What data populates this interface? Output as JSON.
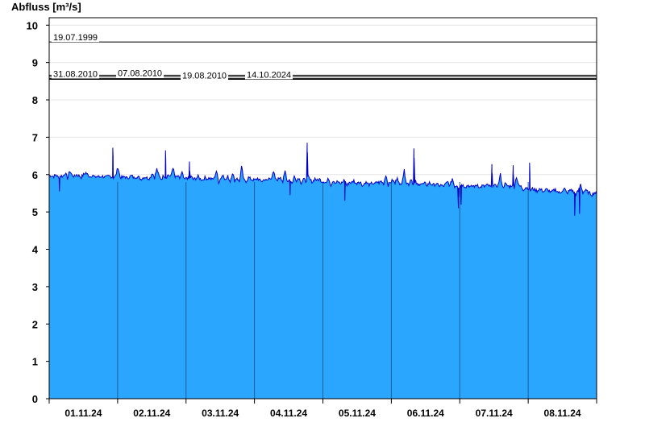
{
  "chart_data": {
    "type": "area",
    "ylabel": "Abfluss [m³/s]",
    "ylim": [
      0,
      10.2
    ],
    "yticks": [
      0,
      1,
      2,
      3,
      4,
      5,
      6,
      7,
      8,
      9,
      10
    ],
    "x_range_days": [
      0,
      8
    ],
    "x_tick_labels": [
      "01.11.24",
      "02.11.24",
      "03.11.24",
      "04.11.24",
      "05.11.24",
      "06.11.24",
      "07.11.24",
      "08.11.24"
    ],
    "grid": true,
    "colors": {
      "fill": "#2ba6ff",
      "line": "#0000cc",
      "day_divider": "#1b5f99",
      "ref_line": "#000000"
    },
    "reference_lines": [
      {
        "label": "19.07.1999",
        "value": 9.55
      },
      {
        "label": "31.08.2010",
        "value": 8.55
      },
      {
        "label": "07.08.2010",
        "value": 8.57
      },
      {
        "label": "19.08.2010",
        "value": 8.62
      },
      {
        "label": "14.10.2024",
        "value": 8.66
      }
    ],
    "series": [
      {
        "values": [
          5.98,
          5.97,
          5.95,
          6.0,
          5.92,
          5.97,
          5.95,
          6.05,
          5.9,
          6.1,
          5.98,
          5.95,
          6.0,
          5.97,
          5.93,
          6.0,
          6.05,
          5.98,
          5.95,
          5.99,
          5.92,
          5.96,
          5.93,
          5.96,
          5.94,
          5.93,
          5.96,
          5.95,
          5.92,
          5.96,
          6.2,
          5.93,
          5.92,
          5.95,
          5.9,
          5.94,
          5.97,
          5.91,
          5.95,
          5.93,
          5.88,
          5.92,
          5.94,
          5.9,
          5.91,
          6.05,
          5.92,
          6.15,
          5.95,
          5.88,
          5.98,
          5.92,
          6.0,
          5.93,
          6.2,
          5.92,
          5.95,
          5.9,
          6.05,
          5.85,
          5.92,
          5.88,
          5.94,
          5.87,
          5.9,
          5.95,
          5.88,
          5.86,
          5.92,
          5.89,
          5.91,
          5.87,
          5.9,
          6.1,
          5.8,
          5.92,
          6.0,
          5.85,
          5.95,
          5.82,
          6.05,
          5.84,
          5.92,
          5.8,
          6.2,
          5.85,
          5.82,
          5.92,
          5.88,
          5.86,
          5.85,
          5.9,
          5.84,
          5.82,
          5.88,
          5.83,
          5.9,
          5.92,
          6.05,
          5.85,
          5.88,
          5.95,
          5.8,
          6.1,
          5.82,
          5.88,
          5.76,
          5.95,
          5.85,
          5.92,
          5.78,
          5.88,
          5.82,
          5.95,
          5.85,
          5.8,
          5.9,
          5.84,
          5.88,
          5.82,
          5.82,
          5.78,
          5.9,
          5.72,
          5.85,
          5.78,
          5.82,
          5.74,
          5.8,
          5.86,
          5.7,
          5.8,
          5.78,
          5.84,
          5.75,
          5.82,
          5.78,
          5.7,
          5.8,
          5.76,
          5.72,
          5.78,
          5.74,
          5.8,
          5.78,
          5.82,
          5.75,
          6.0,
          5.72,
          5.8,
          5.85,
          5.76,
          5.95,
          5.7,
          5.82,
          6.1,
          5.78,
          5.74,
          5.9,
          5.72,
          5.8,
          5.7,
          5.78,
          5.74,
          5.76,
          5.72,
          5.78,
          5.74,
          5.72,
          5.76,
          5.7,
          5.72,
          5.68,
          5.74,
          5.8,
          5.7,
          5.9,
          5.68,
          5.72,
          5.66,
          5.74,
          5.7,
          5.68,
          5.72,
          5.66,
          5.7,
          5.68,
          5.74,
          5.64,
          5.7,
          5.68,
          5.72,
          5.7,
          5.66,
          5.74,
          5.68,
          5.72,
          6.0,
          5.65,
          5.75,
          5.7,
          5.68,
          5.72,
          5.66,
          5.95,
          5.7,
          5.68,
          5.6,
          5.66,
          5.64,
          5.58,
          5.62,
          5.6,
          5.56,
          5.62,
          5.58,
          5.55,
          5.6,
          5.58,
          5.52,
          5.56,
          5.6,
          5.54,
          5.5,
          5.58,
          5.62,
          5.5,
          5.56,
          5.6,
          5.52,
          5.48,
          5.56,
          5.74,
          5.52,
          5.58,
          5.54,
          5.5,
          5.46,
          5.52,
          5.48
        ]
      }
    ],
    "spikes": [
      {
        "day": 0.93,
        "value": 6.72
      },
      {
        "day": 1.7,
        "value": 6.65
      },
      {
        "day": 2.05,
        "value": 6.35
      },
      {
        "day": 3.77,
        "value": 6.85
      },
      {
        "day": 5.33,
        "value": 6.7
      },
      {
        "day": 6.47,
        "value": 6.28
      },
      {
        "day": 6.78,
        "value": 6.25
      },
      {
        "day": 7.02,
        "value": 6.32
      }
    ],
    "dips": [
      {
        "day": 0.15,
        "value": 5.55
      },
      {
        "day": 3.52,
        "value": 5.45
      },
      {
        "day": 4.32,
        "value": 5.3
      },
      {
        "day": 5.98,
        "value": 5.1
      },
      {
        "day": 6.02,
        "value": 5.2
      },
      {
        "day": 7.68,
        "value": 4.9
      },
      {
        "day": 7.75,
        "value": 4.95
      }
    ]
  }
}
